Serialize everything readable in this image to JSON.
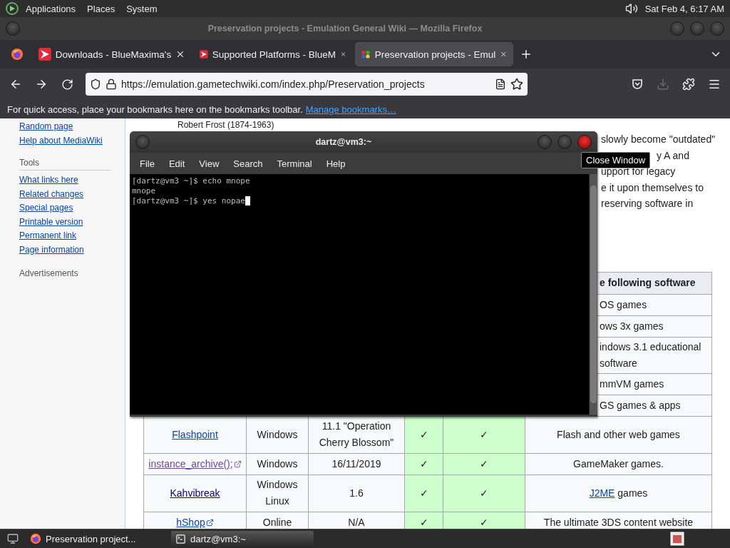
{
  "top_panel": {
    "menus": [
      "Applications",
      "Places",
      "System"
    ],
    "clock": "Sat Feb  4, 6:17 AM"
  },
  "browser": {
    "title": "Preservation projects - Emulation General Wiki — Mozilla Firefox",
    "tabs": [
      {
        "label": "Downloads - BlueMaxima's",
        "kind": "arrow",
        "selected": false
      },
      {
        "label": "Supported Platforms - BlueM",
        "kind": "arrow",
        "selected": false
      },
      {
        "label": "Preservation projects - Emul",
        "kind": "wiki",
        "selected": true
      }
    ],
    "url": "https://emulation.gametechwiki.com/index.php/Preservation_projects",
    "download_disabled": true,
    "bookmarks_hint": "For quick access, place your bookmarks here on the bookmarks toolbar.",
    "bookmarks_link": "Manage bookmarks…"
  },
  "sidebar": {
    "top_links": [
      "Random page",
      "Help about MediaWiki"
    ],
    "tools_heading": "Tools",
    "tools": [
      "What links here",
      "Related changes",
      "Special pages",
      "Printable version",
      "Permanent link",
      "Page information"
    ],
    "ads_heading": "Advertisements"
  },
  "article": {
    "caption": "Robert Frost (1874-1963)",
    "fragments": [
      "slowly become \"outdated\"",
      "y A and",
      "upport for legacy",
      "e it upon themselves to",
      "reserving software in"
    ]
  },
  "table": {
    "rows": [
      {
        "kind": "partial",
        "header": true,
        "fragment": "e following software"
      },
      {
        "kind": "partial",
        "fragment": "OS games"
      },
      {
        "kind": "partial",
        "fragment": "ows 3x games"
      },
      {
        "kind": "partial",
        "fragment": "indows 3.1 educational\nsoftware"
      },
      {
        "kind": "partial",
        "fragment": "mmVM games"
      },
      {
        "kind": "partial",
        "fragment": "GS games & apps"
      },
      {
        "kind": "full",
        "cells": [
          {
            "kind": "link",
            "text": "Flashpoint",
            "visited": false,
            "external": false
          },
          {
            "kind": "text",
            "text": "Windows"
          },
          {
            "kind": "text",
            "text": "11.1 \"Operation\nCherry Blossom\""
          },
          {
            "kind": "check",
            "text": "✓"
          },
          {
            "kind": "check",
            "text": "✓"
          },
          {
            "kind": "text",
            "text": "Flash and other web games"
          }
        ]
      },
      {
        "kind": "full",
        "cells": [
          {
            "kind": "link",
            "text": "instance_archive();",
            "visited": true,
            "external": true
          },
          {
            "kind": "text",
            "text": "Windows"
          },
          {
            "kind": "text",
            "text": "16/11/2019"
          },
          {
            "kind": "check",
            "text": "✓"
          },
          {
            "kind": "check",
            "text": "✓"
          },
          {
            "kind": "text",
            "text": "GameMaker games."
          }
        ]
      },
      {
        "kind": "full",
        "cells": [
          {
            "kind": "link",
            "text": "Kahvibreak",
            "visited": true,
            "external": false
          },
          {
            "kind": "text",
            "text": "Windows\nLinux"
          },
          {
            "kind": "text",
            "text": "1.6"
          },
          {
            "kind": "check",
            "text": "✓"
          },
          {
            "kind": "check",
            "text": "✓"
          },
          {
            "kind": "linktext",
            "link": "J2ME",
            "text": " games"
          }
        ]
      },
      {
        "kind": "full",
        "cells": [
          {
            "kind": "link",
            "text": "hShop",
            "visited": false,
            "external": true
          },
          {
            "kind": "text",
            "text": "Online"
          },
          {
            "kind": "text",
            "text": "N/A"
          },
          {
            "kind": "check",
            "text": "✓"
          },
          {
            "kind": "check",
            "text": "✓"
          },
          {
            "kind": "text",
            "text": "The ultimate 3DS content website"
          }
        ]
      }
    ]
  },
  "terminal": {
    "title": "dartz@vm3:~",
    "menus": [
      "File",
      "Edit",
      "View",
      "Search",
      "Terminal",
      "Help"
    ],
    "lines": [
      "[dartz@vm3 ~]$ echo mnope",
      "mnope",
      "[dartz@vm3 ~]$ yes nopae"
    ],
    "tooltip": "Close Window"
  },
  "taskbar": {
    "items": [
      {
        "label": "Preservation project...",
        "kind": "browser",
        "selected": false
      },
      {
        "label": "dartz@vm3:~",
        "kind": "terminal",
        "selected": true
      }
    ]
  }
}
